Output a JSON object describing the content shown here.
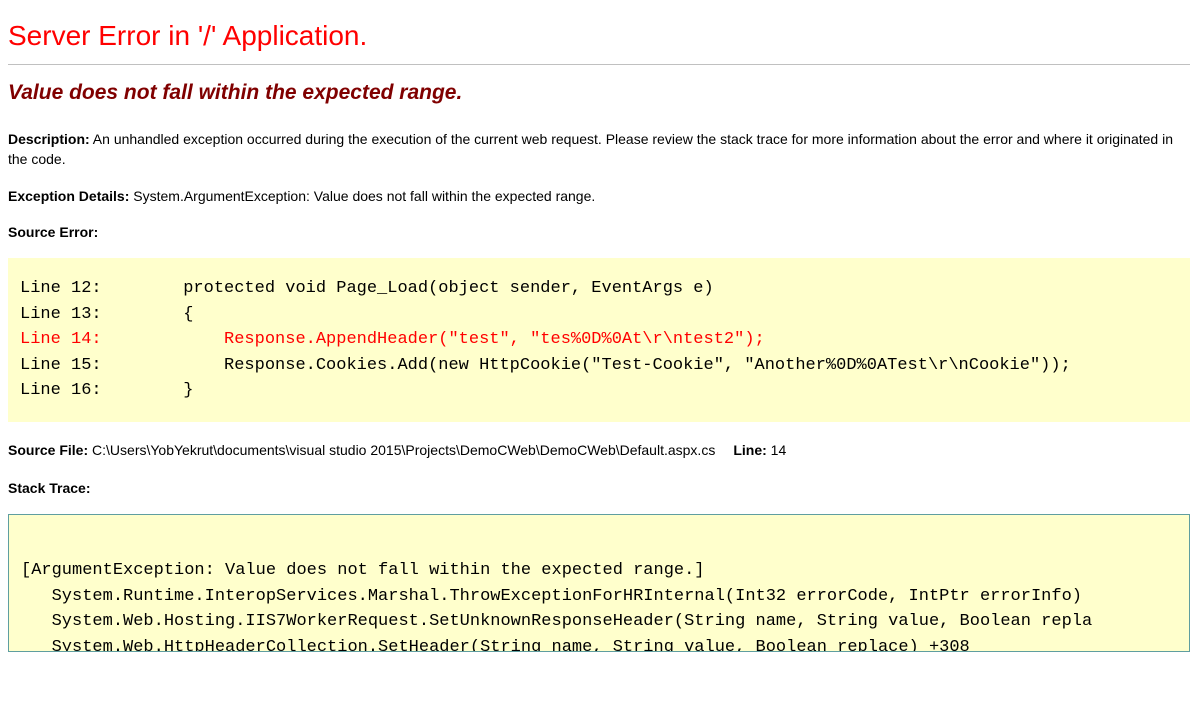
{
  "title": "Server Error in '/' Application.",
  "subtitle": "Value does not fall within the expected range.",
  "description_label": "Description:",
  "description_text": " An unhandled exception occurred during the execution of the current web request. Please review the stack trace for more information about the error and where it originated in the code.",
  "exception_label": "Exception Details:",
  "exception_text": " System.ArgumentException: Value does not fall within the expected range.",
  "source_error_label": "Source Error:",
  "source_lines": [
    {
      "n": "Line 12:",
      "code": "        protected void Page_Load(object sender, EventArgs e)",
      "hl": false
    },
    {
      "n": "Line 13:",
      "code": "        {",
      "hl": false
    },
    {
      "n": "Line 14:",
      "code": "            Response.AppendHeader(\"test\", \"tes%0D%0At\\r\\ntest2\");",
      "hl": true
    },
    {
      "n": "Line 15:",
      "code": "            Response.Cookies.Add(new HttpCookie(\"Test-Cookie\", \"Another%0D%0ATest\\r\\nCookie\"));",
      "hl": false
    },
    {
      "n": "Line 16:",
      "code": "        }",
      "hl": false
    }
  ],
  "source_file_label": "Source File:",
  "source_file_path": " C:\\Users\\YobYekrut\\documents\\visual studio 2015\\Projects\\DemoCWeb\\DemoCWeb\\Default.aspx.cs",
  "line_label": "Line:",
  "line_number": " 14",
  "stack_trace_label": "Stack Trace:",
  "stack_trace_lines": [
    "",
    "[ArgumentException: Value does not fall within the expected range.]",
    "   System.Runtime.InteropServices.Marshal.ThrowExceptionForHRInternal(Int32 errorCode, IntPtr errorInfo)",
    "   System.Web.Hosting.IIS7WorkerRequest.SetUnknownResponseHeader(String name, String value, Boolean repla",
    "   System.Web.HttpHeaderCollection.SetHeader(String name, String value, Boolean replace) +308"
  ]
}
